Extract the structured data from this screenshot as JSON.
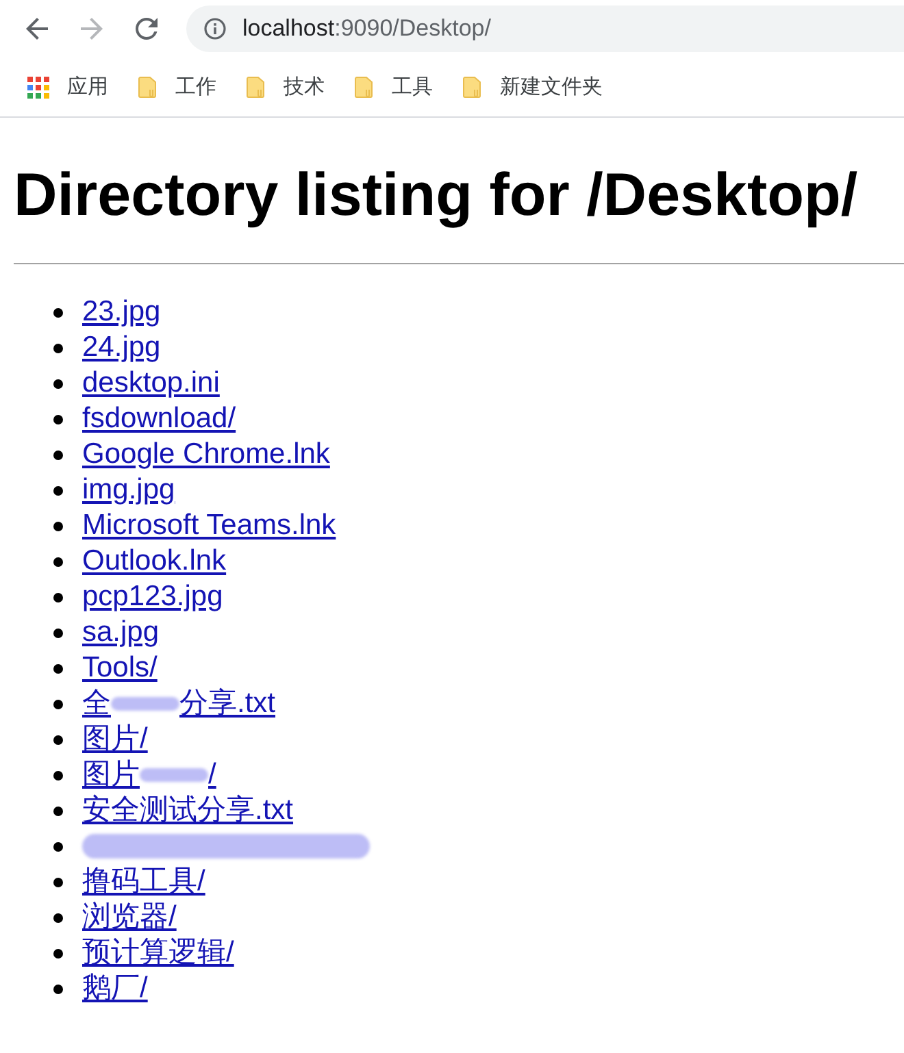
{
  "toolbar": {
    "buttons": [
      {
        "kind": "back",
        "disabled": false
      },
      {
        "kind": "forward",
        "disabled": true
      },
      {
        "kind": "reload",
        "disabled": false
      }
    ],
    "address": {
      "host": "localhost",
      "rest": ":9090/Desktop/"
    }
  },
  "bookmarks_bar": {
    "items": [
      {
        "kind": "apps",
        "label": "应用"
      },
      {
        "kind": "folder",
        "label": "工作"
      },
      {
        "kind": "folder",
        "label": "技术"
      },
      {
        "kind": "folder",
        "label": "工具"
      },
      {
        "kind": "folder",
        "label": "新建文件夹"
      }
    ]
  },
  "page": {
    "heading": "Directory listing for /Desktop/",
    "entries": [
      {
        "kind": "plain",
        "name": "23.jpg"
      },
      {
        "kind": "plain",
        "name": "24.jpg"
      },
      {
        "kind": "plain",
        "name": "desktop.ini"
      },
      {
        "kind": "plain",
        "name": "fsdownload/"
      },
      {
        "kind": "plain",
        "name": "Google Chrome.lnk"
      },
      {
        "kind": "plain",
        "name": "img.jpg"
      },
      {
        "kind": "plain",
        "name": "Microsoft Teams.lnk"
      },
      {
        "kind": "plain",
        "name": "Outlook.lnk"
      },
      {
        "kind": "plain",
        "name": "pcp123.jpg"
      },
      {
        "kind": "plain",
        "name": "sa.jpg"
      },
      {
        "kind": "plain",
        "name": "Tools/"
      },
      {
        "kind": "scribbled",
        "before": "全",
        "after": "分享.txt"
      },
      {
        "kind": "plain",
        "name": "图片/"
      },
      {
        "kind": "scribbled",
        "before": "图片",
        "after": "/"
      },
      {
        "kind": "plain",
        "name": "安全测试分享.txt"
      },
      {
        "kind": "smudged"
      },
      {
        "kind": "plain",
        "name": "撸码工具/"
      },
      {
        "kind": "plain",
        "name": "浏览器/"
      },
      {
        "kind": "plain",
        "name": "预计算逻辑/"
      },
      {
        "kind": "plain",
        "name": "鹅厂/"
      }
    ]
  }
}
